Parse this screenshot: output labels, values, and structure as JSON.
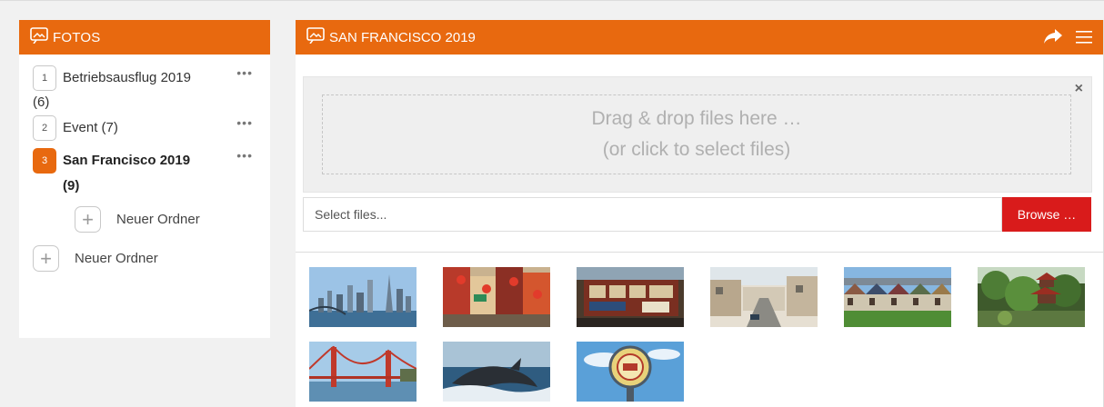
{
  "left_panel": {
    "title": "FOTOS",
    "folders": [
      {
        "number": "1",
        "name": "Betriebsausflug 2019",
        "count": "(6)",
        "active": false
      },
      {
        "number": "2",
        "name": "Event (7)",
        "active": false
      },
      {
        "number": "3",
        "name": "San Francisco 2019 (9)",
        "active": true
      }
    ],
    "more_symbol": "•••",
    "sub_new_folder": "Neuer Ordner",
    "new_folder": "Neuer Ordner"
  },
  "right_panel": {
    "title": "SAN FRANCISCO 2019",
    "dropzone_line1": "Drag & drop files here …",
    "dropzone_line2": "(or click to select files)",
    "close_symbol": "×",
    "file_placeholder": "Select files...",
    "browse_label": "Browse …",
    "photos": [
      "skyline-photo",
      "chinatown-photo",
      "cable-car-photo",
      "street-photo",
      "painted-ladies-photo",
      "pagoda-garden-photo",
      "golden-gate-photo",
      "whale-photo",
      "fishermans-wharf-sign-photo"
    ]
  },
  "colors": {
    "accent": "#e8690f",
    "browse": "#d91b1b",
    "background": "#f1f1f1"
  },
  "icons": {
    "header": "photo-speech-icon",
    "share": "share-arrow-icon",
    "menu": "hamburger-menu-icon",
    "plus": "plus-icon"
  }
}
